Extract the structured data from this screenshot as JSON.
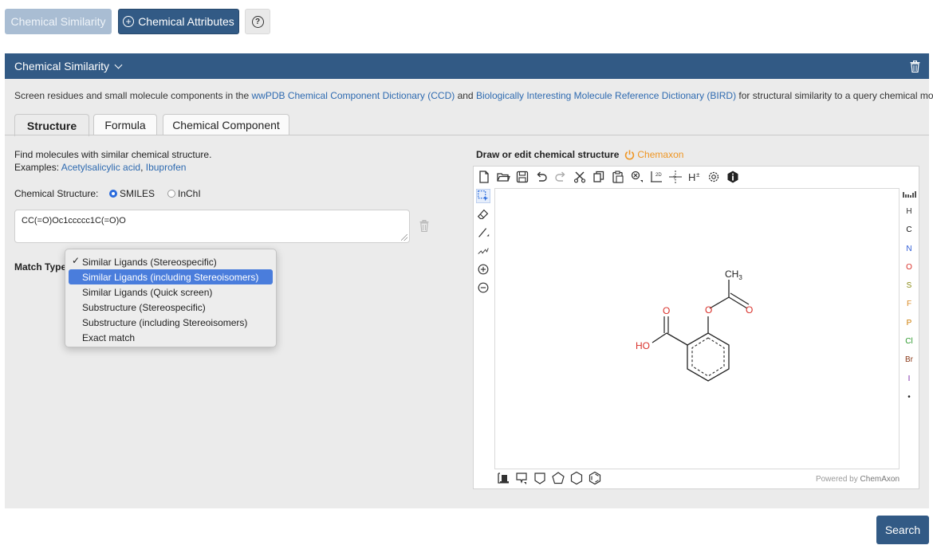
{
  "top_buttons": {
    "similarity_label": "Chemical Similarity",
    "attributes_label": "Chemical Attributes",
    "help_icon": "question-circle-icon"
  },
  "panel": {
    "title": "Chemical Similarity",
    "description": {
      "prefix": "Screen residues and small molecule components in the ",
      "ccd_link": "wwPDB Chemical Component Dictionary (CCD)",
      "and": " and ",
      "bird_link": "Biologically Interesting Molecule Reference Dictionary (BIRD)",
      "suffix": " for structural similarity to a query chemical molecule."
    },
    "tabs": [
      "Structure",
      "Formula",
      "Chemical Component"
    ],
    "active_tab": "Structure"
  },
  "structure": {
    "intro": "Find molecules with similar chemical structure.",
    "examples_label": "Examples: ",
    "example_1": "Acetylsalicylic acid",
    "example_sep": ", ",
    "example_2": "Ibuprofen",
    "chem_label": "Chemical Structure:",
    "format_options": [
      "SMILES",
      "InChI"
    ],
    "selected_format": "SMILES",
    "smiles_value": "CC(=O)Oc1ccccc1C(=O)O",
    "match_label": "Match Type",
    "match_options": [
      "Similar Ligands (Stereospecific)",
      "Similar Ligands (including Stereoisomers)",
      "Similar Ligands (Quick screen)",
      "Substructure (Stereospecific)",
      "Substructure (including Stereoisomers)",
      "Exact match"
    ],
    "checked_option": "Similar Ligands (Stereospecific)",
    "highlighted_option": "Similar Ligands (including Stereoisomers)"
  },
  "editor": {
    "title": "Draw or edit chemical structure",
    "brand": "Chemaxon",
    "elements": [
      "H",
      "C",
      "N",
      "O",
      "S",
      "F",
      "P",
      "Cl",
      "Br",
      "I",
      "•"
    ],
    "powered_prefix": "Powered by ",
    "powered_brand": "ChemAxon",
    "molecule_labels": {
      "methyl": "CH",
      "methyl_sub": "3",
      "oxygen": "O",
      "hydroxyl": "HO"
    }
  },
  "colors": {
    "primary": "#325a85",
    "muted_button": "#a9bdd3",
    "link": "#2e6ab0",
    "highlight": "#4a7ddc",
    "oxygen": "#d9302a",
    "brand_orange": "#ef9624"
  },
  "actions": {
    "search_label": "Search"
  }
}
